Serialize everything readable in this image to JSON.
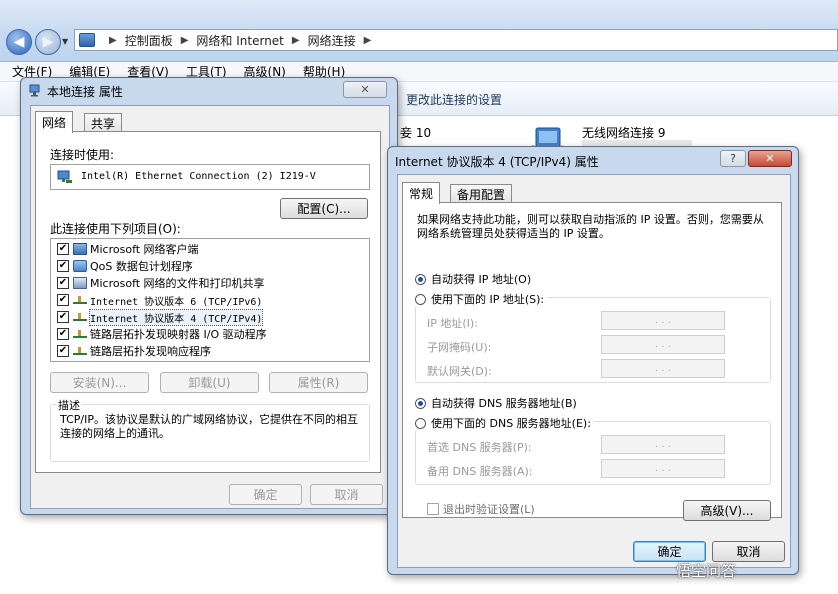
{
  "explorer": {
    "breadcrumb": [
      "控制面板",
      "网络和 Internet",
      "网络连接"
    ],
    "menu": [
      "文件(F)",
      "编辑(E)",
      "查看(V)",
      "工具(T)",
      "高级(N)",
      "帮助(H)"
    ],
    "command_change_settings": "更改此连接的设置",
    "connection_partial": "妾 10",
    "wifi_connection": "无线网络连接 9"
  },
  "local_window": {
    "title": "本地连接 属性",
    "close_glyph": "✕",
    "tabs": [
      "网络",
      "共享"
    ],
    "connect_using_label": "连接时使用:",
    "adapter": "Intel(R) Ethernet Connection (2) I219-V",
    "configure_button": "配置(C)...",
    "items_label": "此连接使用下列项目(O):",
    "items": [
      {
        "label": "Microsoft 网络客户端",
        "checked": true,
        "icon": "network-client-icon"
      },
      {
        "label": "QoS 数据包计划程序",
        "checked": true,
        "icon": "qos-icon"
      },
      {
        "label": "Microsoft 网络的文件和打印机共享",
        "checked": true,
        "icon": "file-share-icon"
      },
      {
        "label": "Internet 协议版本 6 (TCP/IPv6)",
        "checked": true,
        "icon": "protocol-icon"
      },
      {
        "label": "Internet 协议版本 4 (TCP/IPv4)",
        "checked": true,
        "icon": "protocol-icon"
      },
      {
        "label": "链路层拓扑发现映射器 I/O 驱动程序",
        "checked": true,
        "icon": "protocol-icon"
      },
      {
        "label": "链路层拓扑发现响应程序",
        "checked": true,
        "icon": "protocol-icon"
      }
    ],
    "install_button": "安装(N)...",
    "uninstall_button": "卸载(U)",
    "properties_button": "属性(R)",
    "description_legend": "描述",
    "description_text": "TCP/IP。该协议是默认的广域网络协议，它提供在不同的相互连接的网络上的通讯。",
    "ok_button": "确定",
    "cancel_button": "取消"
  },
  "ipv4_window": {
    "title": "Internet 协议版本 4 (TCP/IPv4) 属性",
    "help_glyph": "?",
    "close_glyph": "✕",
    "tabs": [
      "常规",
      "备用配置"
    ],
    "intro": "如果网络支持此功能，则可以获取自动指派的 IP 设置。否则，您需要从网络系统管理员处获得适当的 IP 设置。",
    "auto_ip": "自动获得 IP 地址(O)",
    "manual_ip": "使用下面的 IP 地址(S):",
    "ip_fields": [
      "IP 地址(I):",
      "子网掩码(U):",
      "默认网关(D):"
    ],
    "auto_dns": "自动获得 DNS 服务器地址(B)",
    "manual_dns": "使用下面的 DNS 服务器地址(E):",
    "dns_fields": [
      "首选 DNS 服务器(P):",
      "备用 DNS 服务器(A):"
    ],
    "ip_dots": ".   .   .",
    "validate_label": "退出时验证设置(L)",
    "advanced_button": "高级(V)...",
    "ok_button": "确定",
    "cancel_button": "取消",
    "auto_ip_selected": true,
    "auto_dns_selected": true
  },
  "watermark": "悟空问答",
  "colors": {
    "accent": "#3c7fb1",
    "close_red": "#c64a35",
    "disabled_text": "#9a9a9a"
  }
}
